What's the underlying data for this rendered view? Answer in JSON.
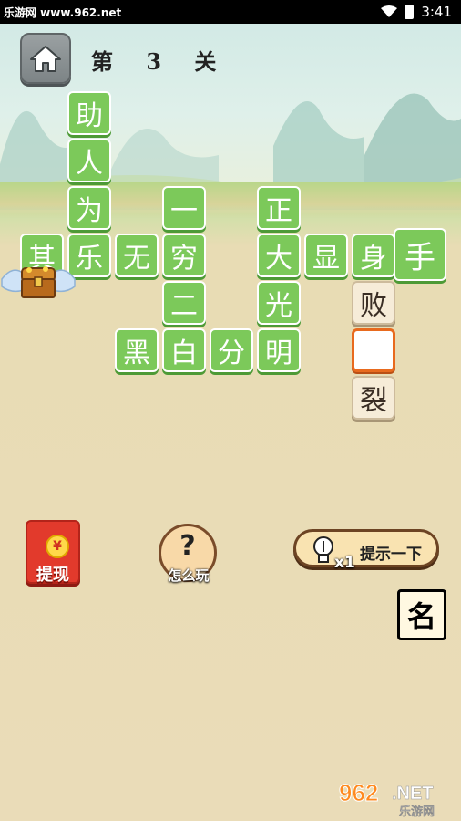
{
  "status_bar": {
    "site_label": "乐游网 www.962.net",
    "time": "3:41"
  },
  "header": {
    "level_prefix": "第",
    "level_number": "3",
    "level_suffix": "关"
  },
  "board": {
    "tiles": [
      {
        "id": "t1",
        "char": "助",
        "style": "green"
      },
      {
        "id": "t2",
        "char": "人",
        "style": "green"
      },
      {
        "id": "t3",
        "char": "为",
        "style": "green"
      },
      {
        "id": "t4",
        "char": "其",
        "style": "green"
      },
      {
        "id": "t5",
        "char": "乐",
        "style": "green"
      },
      {
        "id": "t6",
        "char": "无",
        "style": "green"
      },
      {
        "id": "t7",
        "char": "穷",
        "style": "green"
      },
      {
        "id": "t8",
        "char": "一",
        "style": "green"
      },
      {
        "id": "t9",
        "char": "二",
        "style": "green"
      },
      {
        "id": "t10",
        "char": "黑",
        "style": "green"
      },
      {
        "id": "t11",
        "char": "白",
        "style": "green"
      },
      {
        "id": "t12",
        "char": "分",
        "style": "green"
      },
      {
        "id": "t13",
        "char": "明",
        "style": "green"
      },
      {
        "id": "t14",
        "char": "正",
        "style": "green"
      },
      {
        "id": "t15",
        "char": "大",
        "style": "green"
      },
      {
        "id": "t16",
        "char": "光",
        "style": "green"
      },
      {
        "id": "t17",
        "char": "显",
        "style": "green"
      },
      {
        "id": "t18",
        "char": "身",
        "style": "green"
      },
      {
        "id": "t19",
        "char": "手",
        "style": "green"
      },
      {
        "id": "t20",
        "char": "败",
        "style": "beige"
      },
      {
        "id": "t21",
        "char": "",
        "style": "empty"
      },
      {
        "id": "t22",
        "char": "裂",
        "style": "beige"
      }
    ]
  },
  "controls": {
    "red_packet_label": "提现",
    "red_packet_symbol": "¥",
    "how_to_play_symbol": "?",
    "how_to_play_label": "怎么玩",
    "hint_label": "提示一下",
    "hint_count": "x1"
  },
  "candidates": [
    {
      "char": "名"
    }
  ],
  "branding": {
    "logo_number": "962",
    "logo_suffix": ".NET",
    "logo_text": "乐游网"
  }
}
